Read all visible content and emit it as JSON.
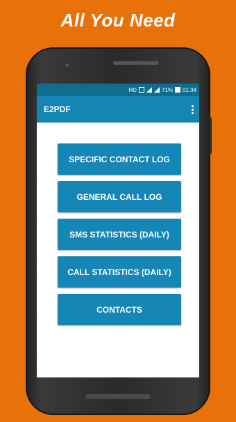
{
  "headline": "All You Need",
  "status_bar": {
    "network": "HD",
    "battery": "71%",
    "time": "01:34"
  },
  "app_bar": {
    "title": "E2PDF",
    "menu_icon": "overflow-menu-icon"
  },
  "buttons": [
    {
      "label": "SPECIFIC CONTACT LOG"
    },
    {
      "label": "GENERAL CALL LOG"
    },
    {
      "label": "SMS STATISTICS (DAILY)"
    },
    {
      "label": "CALL STATISTICS (DAILY)"
    },
    {
      "label": "CONTACTS"
    }
  ],
  "colors": {
    "background": "#E8710A",
    "status_bar": "#0F6E90",
    "app_bar": "#1585B5",
    "button": "#1686B7"
  }
}
